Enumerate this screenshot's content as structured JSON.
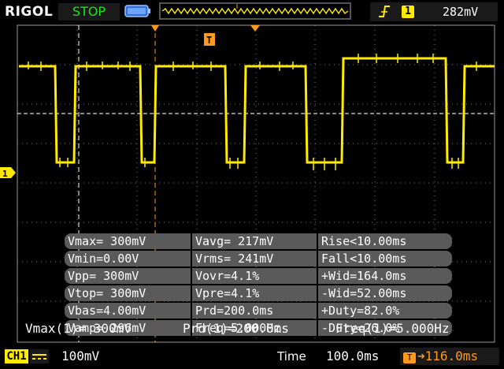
{
  "header": {
    "brand": "RIGOL",
    "run_state": "STOP",
    "trigger": {
      "edge_icon": "rising-edge-icon",
      "channel": "1",
      "level": "282mV"
    }
  },
  "screen": {
    "channel_marker": "1",
    "trigger_marker": "T",
    "grid": true
  },
  "measurements": {
    "rows": [
      [
        "Vmax= 300mV",
        "Vavg= 217mV",
        "Rise<10.00ms"
      ],
      [
        "Vmin=0.00V",
        "Vrms= 241mV",
        "Fall<10.00ms"
      ],
      [
        "Vpp= 300mV",
        "Vovr=4.1%",
        "+Wid=164.0ms"
      ],
      [
        "Vtop= 300mV",
        "Vpre=4.1%",
        "-Wid=52.00ms"
      ],
      [
        "Vbas=4.00mV",
        "Prd=200.0ms",
        "+Duty=82.0%"
      ],
      [
        "Vamp= 296mV",
        "Freq=5.000Hz",
        "-Duty=26.0%"
      ]
    ]
  },
  "summary": {
    "vmax": "Vmax(1)= 300mV",
    "prd": "Prd(1)=200.0ms",
    "freq": "Freq(1)=5.000Hz"
  },
  "footer": {
    "channel": "CH1",
    "coupling_icon": "dc-coupling-icon",
    "vertical_scale": "100mV",
    "time_label": "Time",
    "time_value": "100.0ms",
    "trigger_offset_badge": "T",
    "trigger_offset": "116.0ms"
  },
  "colors": {
    "trace": "#ffea00",
    "trigger_marker": "#ff9a1a",
    "run_state": "#19e619",
    "grid": "#9a9a9a",
    "measure_bg": "#5a5a5a"
  }
}
